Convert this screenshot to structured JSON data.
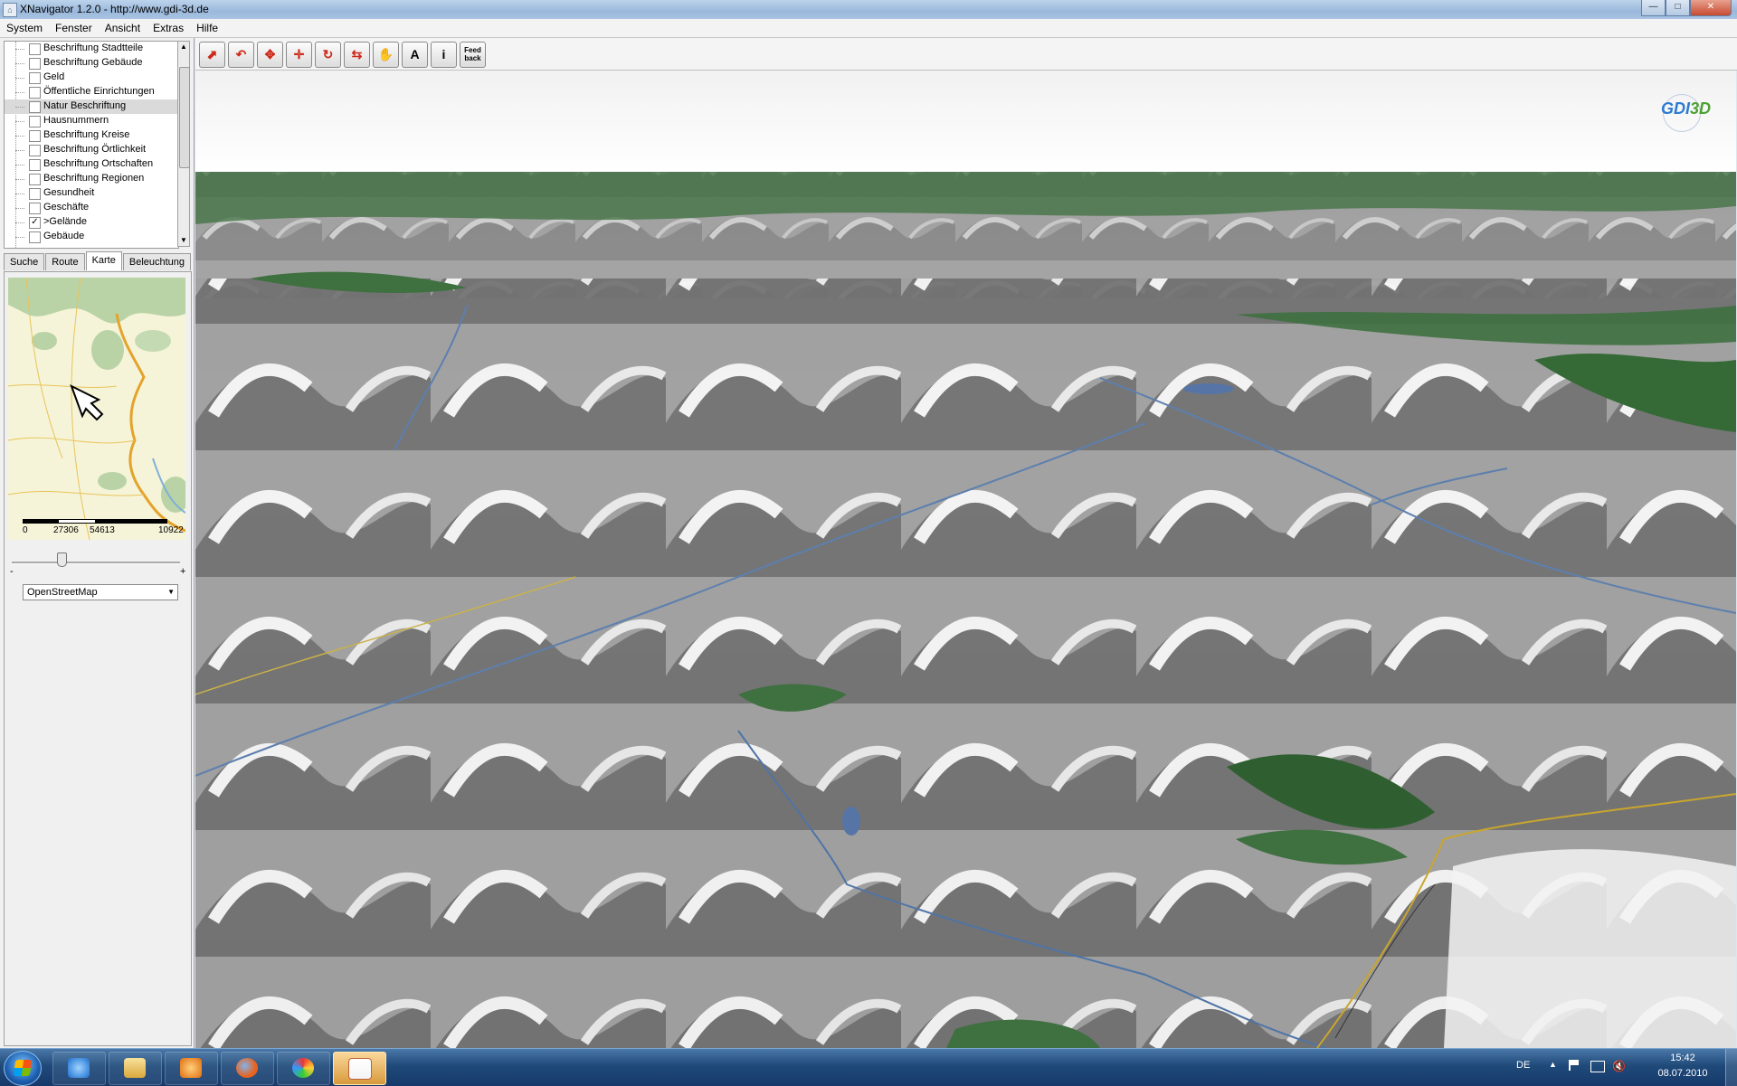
{
  "window": {
    "title": "XNavigator 1.2.0 - http://www.gdi-3d.de"
  },
  "menu": [
    "System",
    "Fenster",
    "Ansicht",
    "Extras",
    "Hilfe"
  ],
  "layers": [
    {
      "label": "Beschriftung Stadtteile",
      "checked": false
    },
    {
      "label": "Beschriftung Gebäude",
      "checked": false
    },
    {
      "label": "Geld",
      "checked": false
    },
    {
      "label": "Öffentliche Einrichtungen",
      "checked": false
    },
    {
      "label": "Natur Beschriftung",
      "checked": false,
      "selected": true
    },
    {
      "label": "Hausnummern",
      "checked": false
    },
    {
      "label": "Beschriftung Kreise",
      "checked": false
    },
    {
      "label": "Beschriftung Örtlichkeit",
      "checked": false
    },
    {
      "label": "Beschriftung Ortschaften",
      "checked": false
    },
    {
      "label": "Beschriftung Regionen",
      "checked": false
    },
    {
      "label": "Gesundheit",
      "checked": false
    },
    {
      "label": "Geschäfte",
      "checked": false
    },
    {
      "label": ">Gelände",
      "checked": true
    },
    {
      "label": "Gebäude",
      "checked": false
    }
  ],
  "tabs": [
    {
      "label": "Suche",
      "active": false
    },
    {
      "label": "Route",
      "active": false
    },
    {
      "label": "Karte",
      "active": true
    },
    {
      "label": "Beleuchtung",
      "active": false
    }
  ],
  "scale": {
    "labels": [
      "0",
      "27306",
      "54613",
      "10922"
    ]
  },
  "zoom": {
    "minus": "-",
    "plus": "+",
    "level": 0.3
  },
  "map_source": {
    "selected": "OpenStreetMap"
  },
  "toolbar": {
    "tools": [
      {
        "name": "tool-move-forward-icon"
      },
      {
        "name": "tool-tilt-icon"
      },
      {
        "name": "tool-pan-arrows-icon"
      },
      {
        "name": "tool-move-arrows-icon"
      },
      {
        "name": "tool-rotate-icon"
      },
      {
        "name": "tool-undo-icon"
      },
      {
        "name": "tool-hand-icon"
      },
      {
        "name": "tool-annotation-icon",
        "glyph": "A"
      },
      {
        "name": "tool-info-icon",
        "glyph": "i"
      },
      {
        "name": "tool-feedback-icon",
        "glyph": "Feed back"
      }
    ]
  },
  "logo": {
    "part1": "GDI",
    "part2": "3D"
  },
  "taskbar": {
    "apps": [
      "internet-explorer-icon",
      "explorer-folder-icon",
      "media-player-icon",
      "firefox-icon",
      "paint-icon",
      "java-icon"
    ],
    "language": "DE",
    "time": "15:42",
    "date": "08.07.2010"
  }
}
